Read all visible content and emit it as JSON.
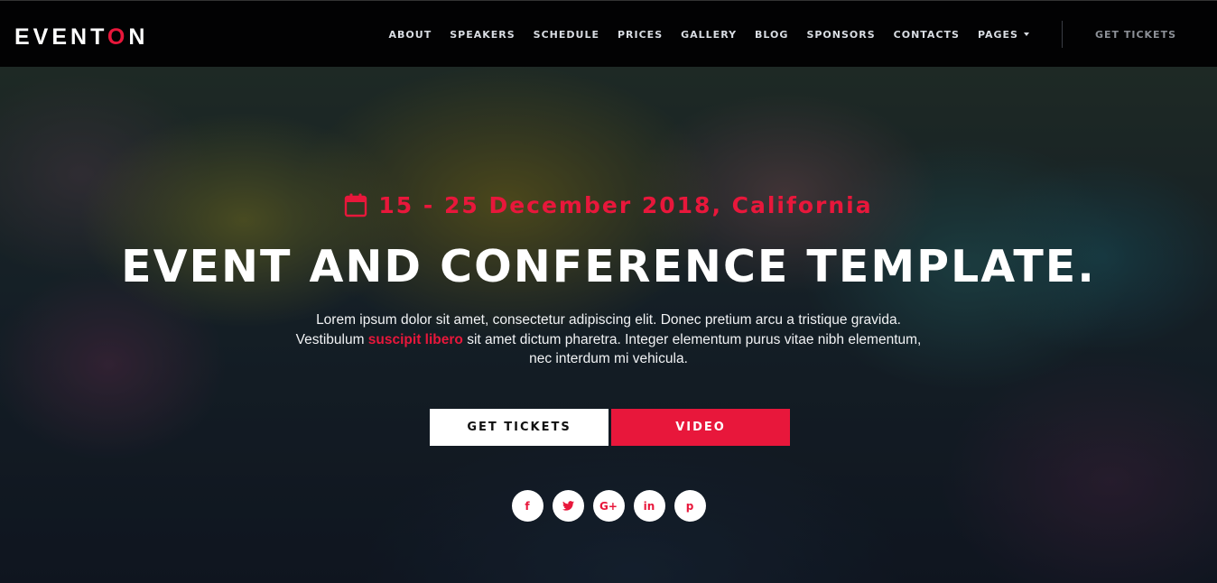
{
  "header": {
    "logo": {
      "part1": "EVENT",
      "accent": "O",
      "part2": "N"
    },
    "nav": [
      {
        "label": "ABOUT"
      },
      {
        "label": "SPEAKERS"
      },
      {
        "label": "SCHEDULE"
      },
      {
        "label": "PRICES"
      },
      {
        "label": "GALLERY"
      },
      {
        "label": "BLOG"
      },
      {
        "label": "SPONSORS"
      },
      {
        "label": "CONTACTS"
      },
      {
        "label": "PAGES"
      }
    ],
    "cta": "GET TICKETS"
  },
  "hero": {
    "date_text": "15 - 25 December 2018, California",
    "headline": "EVENT AND CONFERENCE TEMPLATE.",
    "description": {
      "before": "Lorem ipsum dolor sit amet, consectetur adipiscing elit. Donec pretium arcu a tristique gravida. Vestibulum ",
      "highlight": "suscipit libero",
      "after": " sit amet dictum pharetra. Integer elementum purus vitae nibh elementum, nec interdum mi vehicula."
    },
    "buttons": {
      "primary": "GET TICKETS",
      "secondary": "VIDEO"
    },
    "social": [
      {
        "icon": "facebook-icon",
        "glyph": "f"
      },
      {
        "icon": "twitter-icon",
        "glyph": "t"
      },
      {
        "icon": "google-plus-icon",
        "glyph": "G+"
      },
      {
        "icon": "linkedin-icon",
        "glyph": "in"
      },
      {
        "icon": "pinterest-icon",
        "glyph": "p"
      }
    ]
  },
  "colors": {
    "accent": "#e8173b",
    "header_bg": "#020203",
    "text_light": "#ffffff"
  }
}
